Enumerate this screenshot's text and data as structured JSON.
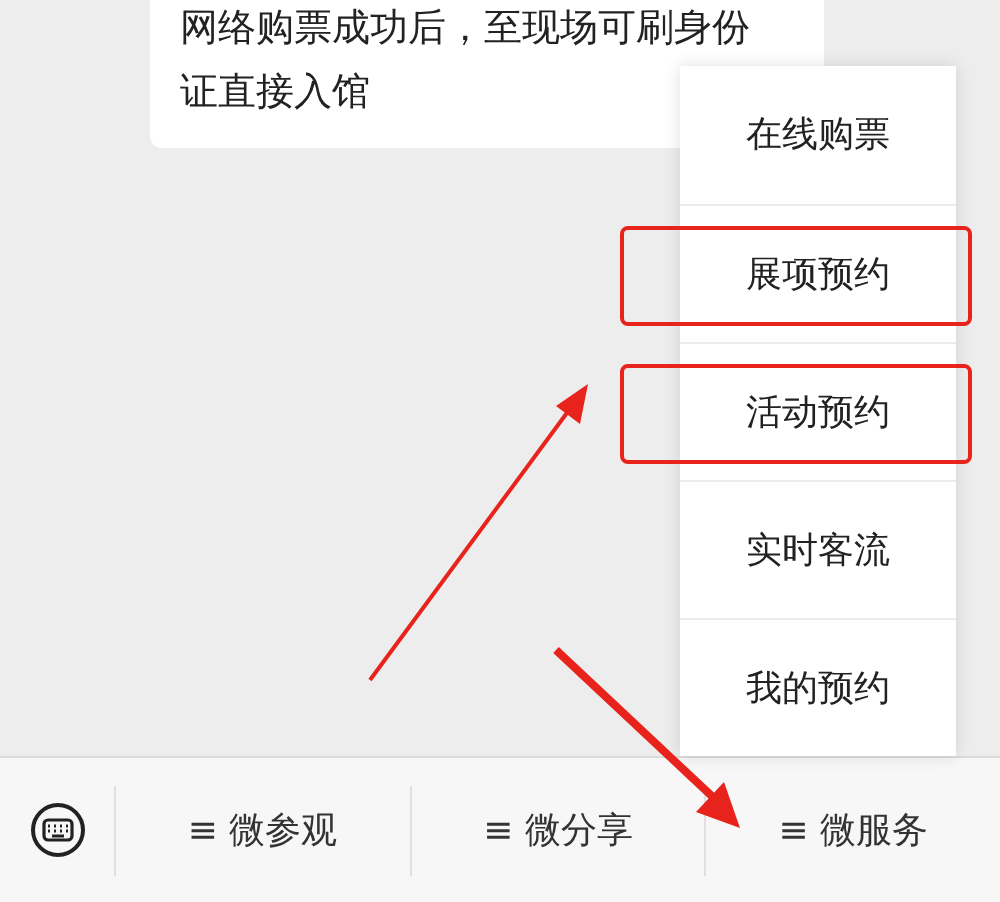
{
  "message": {
    "text": "网络购票成功后，至现场可刷身份证直接入馆"
  },
  "popup_menu": {
    "items": [
      {
        "label": "在线购票",
        "highlighted": false
      },
      {
        "label": "展项预约",
        "highlighted": true
      },
      {
        "label": "活动预约",
        "highlighted": true
      },
      {
        "label": "实时客流",
        "highlighted": false
      },
      {
        "label": "我的预约",
        "highlighted": false
      }
    ]
  },
  "bottom_menu": [
    {
      "label": "≡ 微参观"
    },
    {
      "label": "≡ 微分享"
    },
    {
      "label": "≡ 微服务"
    }
  ]
}
